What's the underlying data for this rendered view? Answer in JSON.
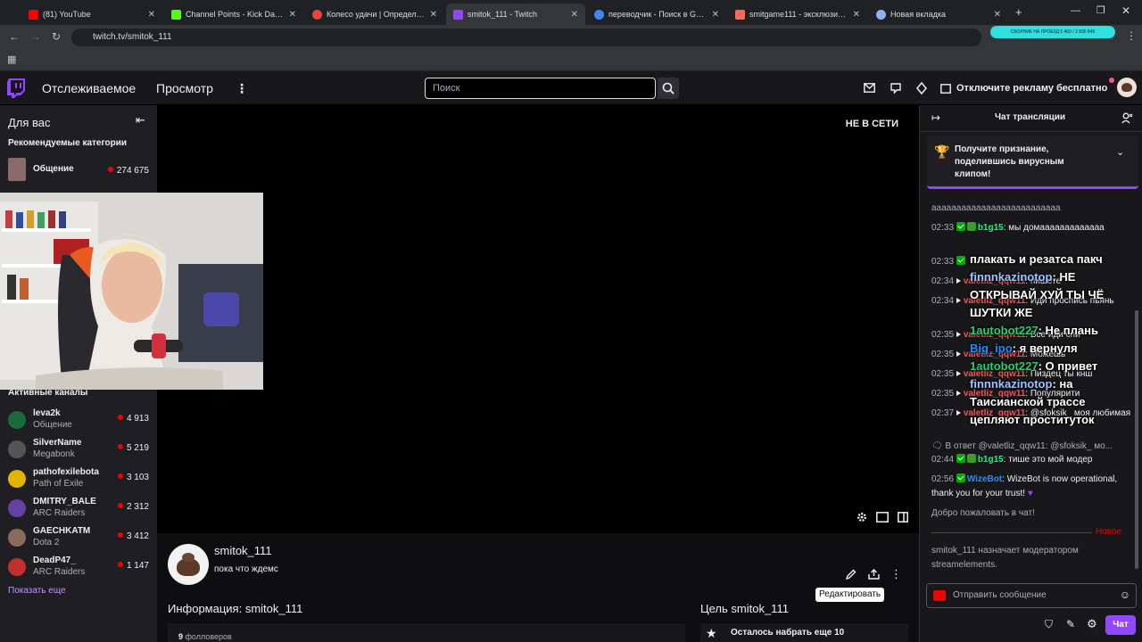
{
  "browser": {
    "tabs": [
      {
        "title": "(81) YouTube",
        "color": "#ff0000"
      },
      {
        "title": "Channel Points - Kick Dashboar",
        "color": "#53fc18"
      },
      {
        "title": "Колесо удачи | Определите п",
        "color": "#e8453c"
      },
      {
        "title": "smitok_111 - Twitch",
        "color": "#9146ff"
      },
      {
        "title": "переводчик - Поиск в Googl",
        "color": "#4285f4"
      },
      {
        "title": "smitgame111 - эксклюзивный",
        "color": "#f96854"
      },
      {
        "title": "Новая вкладка",
        "color": "#8ab4f8"
      }
    ],
    "url": "twitch.tv/smitok_111",
    "ext_banner": "СБОРНИК НА ПРОЕЗД 5 460 / 2 830 846"
  },
  "topnav": {
    "following": "Отслеживаемое",
    "browse": "Просмотр",
    "search_placeholder": "Поиск",
    "promo": "Отключите рекламу бесплатно"
  },
  "sidebar": {
    "for_you": "Для вас",
    "recommended_categories": "Рекомендуемые категории",
    "category": {
      "name": "Общение",
      "viewers": "274 675"
    },
    "active_channels": "Активные каналы",
    "channels": [
      {
        "name": "leva2k",
        "game": "Общение",
        "viewers": "4 913",
        "color": "#1a6b3a"
      },
      {
        "name": "SilverName",
        "game": "Megabonk",
        "viewers": "5 219",
        "color": "#555"
      },
      {
        "name": "pathofexilebota",
        "game": "Path of Exile",
        "viewers": "3 103",
        "color": "#e0b400"
      },
      {
        "name": "DMITRY_BALE",
        "game": "ARC Raiders",
        "viewers": "2 312",
        "color": "#6441a5"
      },
      {
        "name": "GAECHKATM",
        "game": "Dota 2",
        "viewers": "3 412",
        "color": "#8a6a5a"
      },
      {
        "name": "DeadP47_",
        "game": "ARC Raiders",
        "viewers": "1 147",
        "color": "#c03030"
      }
    ],
    "show_more": "Показать еще"
  },
  "player": {
    "offline": "НЕ В СЕТИ"
  },
  "channel": {
    "name": "smitok_111",
    "status": "пока что ждемс",
    "edit_tooltip": "Редактировать",
    "about": "Информация: smitok_111",
    "followers_count": "9",
    "followers_label": "фолловеров",
    "goal": "Цель smitok_111",
    "goal_text": "Осталось набрать еще 10"
  },
  "chat": {
    "title": "Чат трансляции",
    "clip_promo": "Получите признание, поделившись вирусным клипом!",
    "messages": [
      {
        "ts": "02:33",
        "user": "b1g15",
        "color": "#00ff7f",
        "text": "аааааааааааааааааааааааааа"
      },
      {
        "ts": "02:33",
        "user": "b1g15",
        "color": "#00ff7f",
        "text": "мы домааааааааааааа"
      },
      {
        "ts": "02:33",
        "user": "",
        "color": "#ff4d4d",
        "text": ""
      },
      {
        "ts": "02:34",
        "user": "valetliz_qqw11",
        "color": "#ff4d4d",
        "text": "пишете"
      },
      {
        "ts": "02:34",
        "user": "valetliz_qqw11",
        "color": "#ff4d4d",
        "text": "Иди проспись пьянь"
      },
      {
        "ts": "02:35",
        "user": "valetliz_qqw11",
        "color": "#ff4d4d",
        "text": "Все иди спи"
      },
      {
        "ts": "02:35",
        "user": "valetliz_qqw11",
        "color": "#ff4d4d",
        "text": "Можешь"
      },
      {
        "ts": "02:35",
        "user": "valetliz_qqw11",
        "color": "#ff4d4d",
        "text": "Пиздец ты кнш"
      },
      {
        "ts": "02:35",
        "user": "valetliz_qqw11",
        "color": "#ff4d4d",
        "text": "Популярити"
      },
      {
        "ts": "02:37",
        "user": "valetliz_qqw11",
        "color": "#ff4d4d",
        "text": "@sfoksik_ моя любимая"
      }
    ],
    "overlay": [
      {
        "user": "",
        "text": "плакать и резатса пакч"
      },
      {
        "user": "finnnkazinotop",
        "color": "#a0c4ff",
        "text": "НЕ ОТКРЫВАЙ ХУЙ ТЫ ЧЁ ШУТКИ ЖЕ"
      },
      {
        "user": "1autobot227",
        "color": "#2ecc71",
        "text": "Не плань"
      },
      {
        "user": "Big_ipo",
        "color": "#1e90ff",
        "text": "я вернуля"
      },
      {
        "user": "1autobot227",
        "color": "#2ecc71",
        "text": "О привет"
      },
      {
        "user": "finnnkazinotop",
        "color": "#a0c4ff",
        "text": "на Таисианской трассе цепляют проституток"
      }
    ],
    "reply": "В ответ @valetliz_qqw11: @sfoksik_ мо...",
    "reply_msg": {
      "ts": "02:44",
      "user": "b1g15",
      "color": "#00ff7f",
      "text": "тише это мой модер"
    },
    "wizebot": {
      "ts": "02:56",
      "user": "WizeBot",
      "color": "#1e90ff",
      "text": "WizeBot is now operational, thank you for your trust!"
    },
    "welcome": "Добро пожаловать в чат!",
    "new_label": "Новое",
    "mod_notice": "smitok_111 назначает модератором streamelements.",
    "input_placeholder": "Отправить сообщение",
    "send_button": "Чат"
  }
}
